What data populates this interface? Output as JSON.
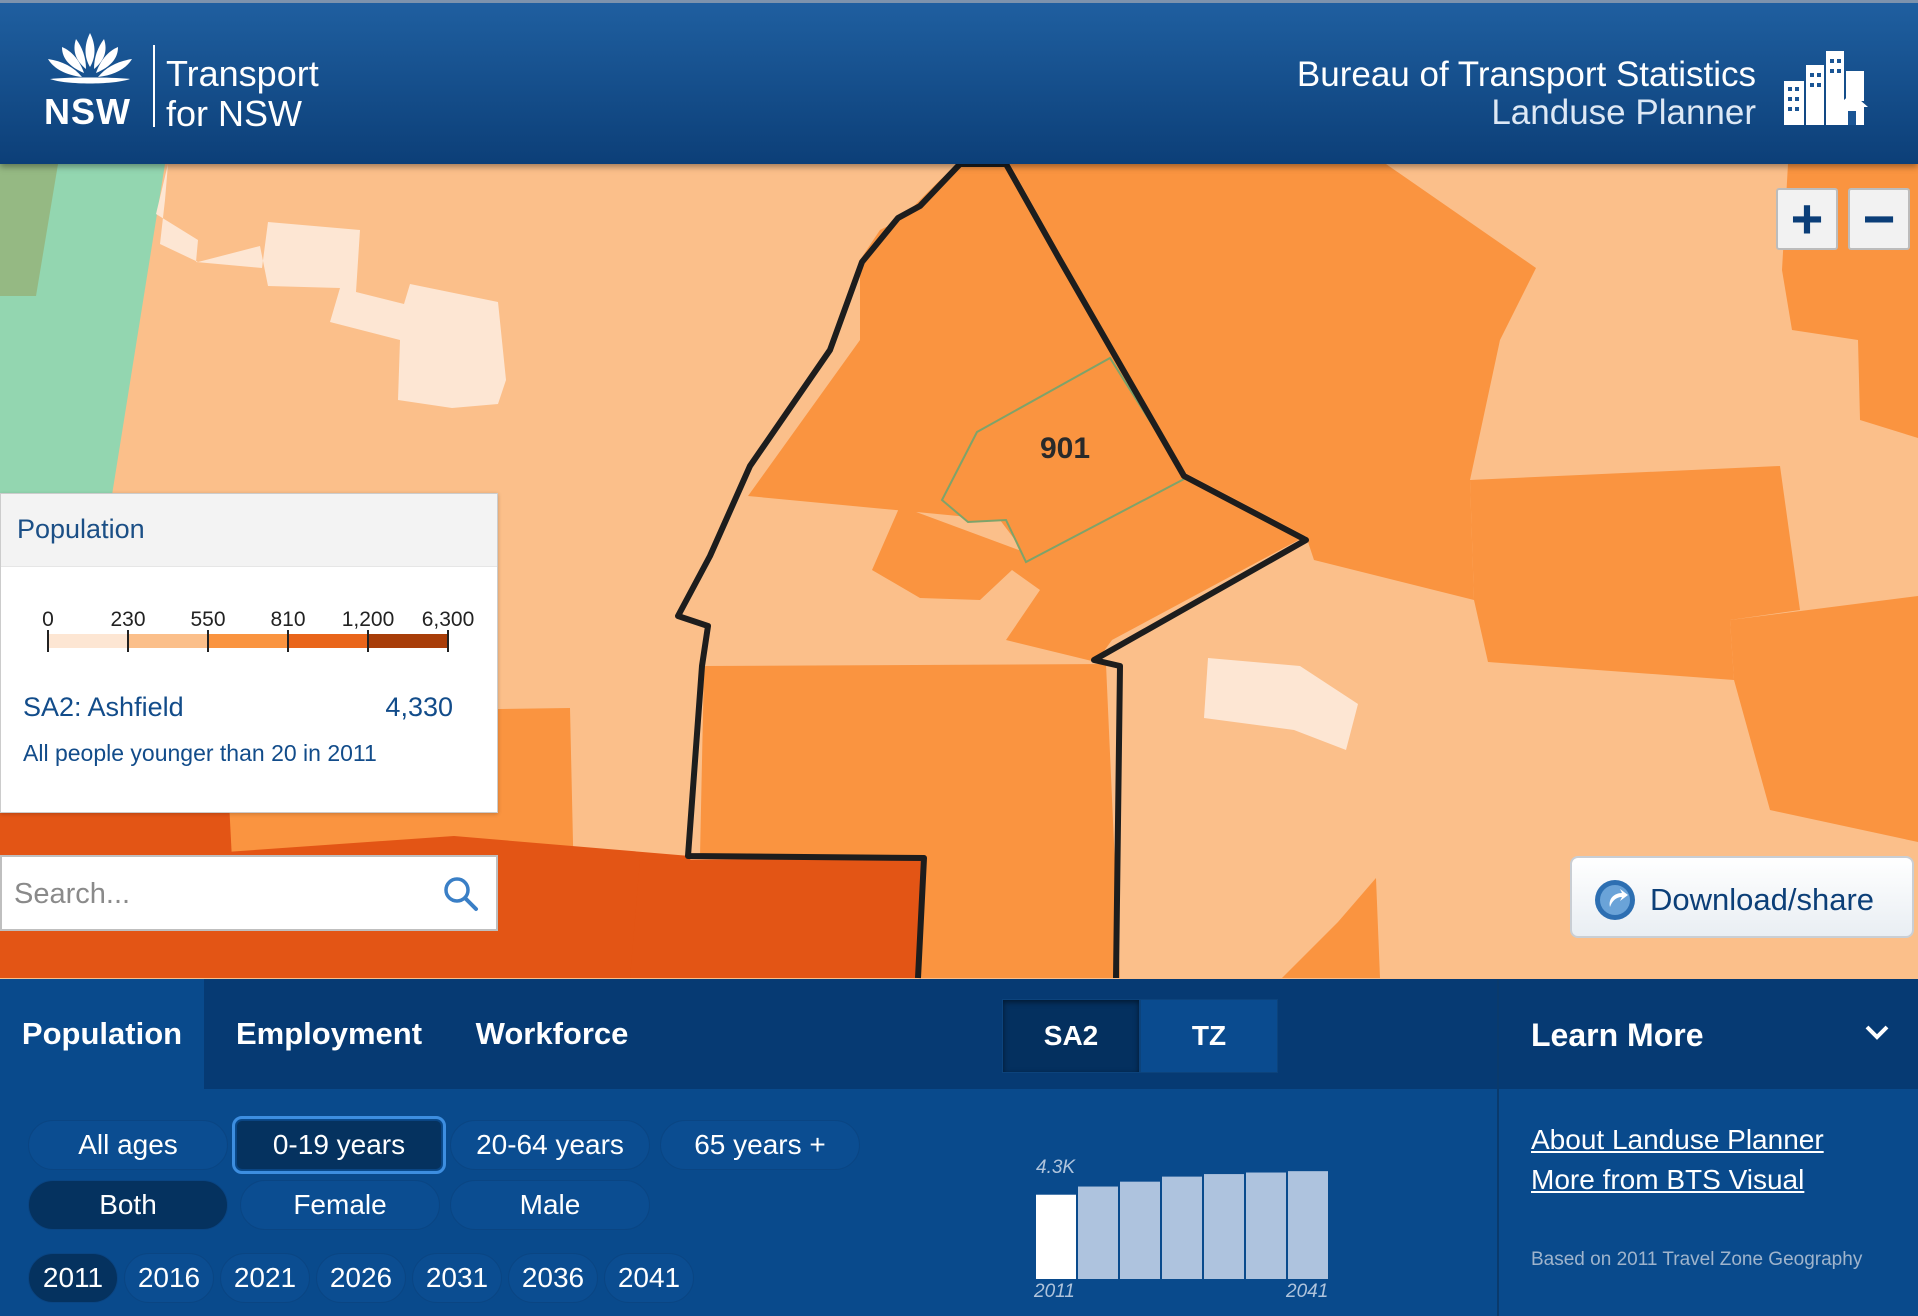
{
  "header": {
    "logo_nsw": "NSW",
    "logo_line1": "Transport",
    "logo_line2": "for NSW",
    "title": "Bureau of Transport Statistics",
    "subtitle": "Landuse Planner"
  },
  "map": {
    "zone_label": "901",
    "zoom_in": "+",
    "zoom_out": "−"
  },
  "legend": {
    "title": "Population",
    "ticks": [
      "0",
      "230",
      "550",
      "810",
      "1,200",
      "6,300"
    ],
    "colors": [
      "#fde6d3",
      "#fbbf8a",
      "#fa9440",
      "#e9651a",
      "#a83d08"
    ],
    "area_name": "SA2: Ashfield",
    "area_value": "4,330",
    "description": "All people younger than 20 in 2011"
  },
  "search": {
    "placeholder": "Search..."
  },
  "download": {
    "label": "Download/share"
  },
  "tabs": {
    "items": [
      "Population",
      "Employment",
      "Workforce"
    ],
    "active": "Population"
  },
  "geography": {
    "options": [
      "SA2",
      "TZ"
    ],
    "selected": "SA2"
  },
  "filters": {
    "ages": [
      "All ages",
      "0-19 years",
      "20-64 years",
      "65 years +"
    ],
    "age_selected": "0-19 years",
    "sex": [
      "Both",
      "Female",
      "Male"
    ],
    "sex_selected": "Both",
    "years": [
      "2011",
      "2016",
      "2021",
      "2026",
      "2031",
      "2036",
      "2041"
    ],
    "year_selected": "2011"
  },
  "mini_chart": {
    "top_label": "4.3K",
    "start_label": "2011",
    "end_label": "2041"
  },
  "chart_data": {
    "type": "bar",
    "categories": [
      "2011",
      "2016",
      "2021",
      "2026",
      "2031",
      "2036",
      "2041"
    ],
    "values": [
      4330,
      4750,
      5000,
      5260,
      5390,
      5470,
      5540
    ],
    "ylabel": "",
    "highlight": "2011",
    "colors": {
      "highlight": "#ffffff",
      "other": "#aec3de"
    }
  },
  "learn_more": {
    "title": "Learn More",
    "links": [
      "About Landuse Planner",
      "More from BTS Visual"
    ],
    "note": "Based on 2011 Travel Zone Geography"
  }
}
